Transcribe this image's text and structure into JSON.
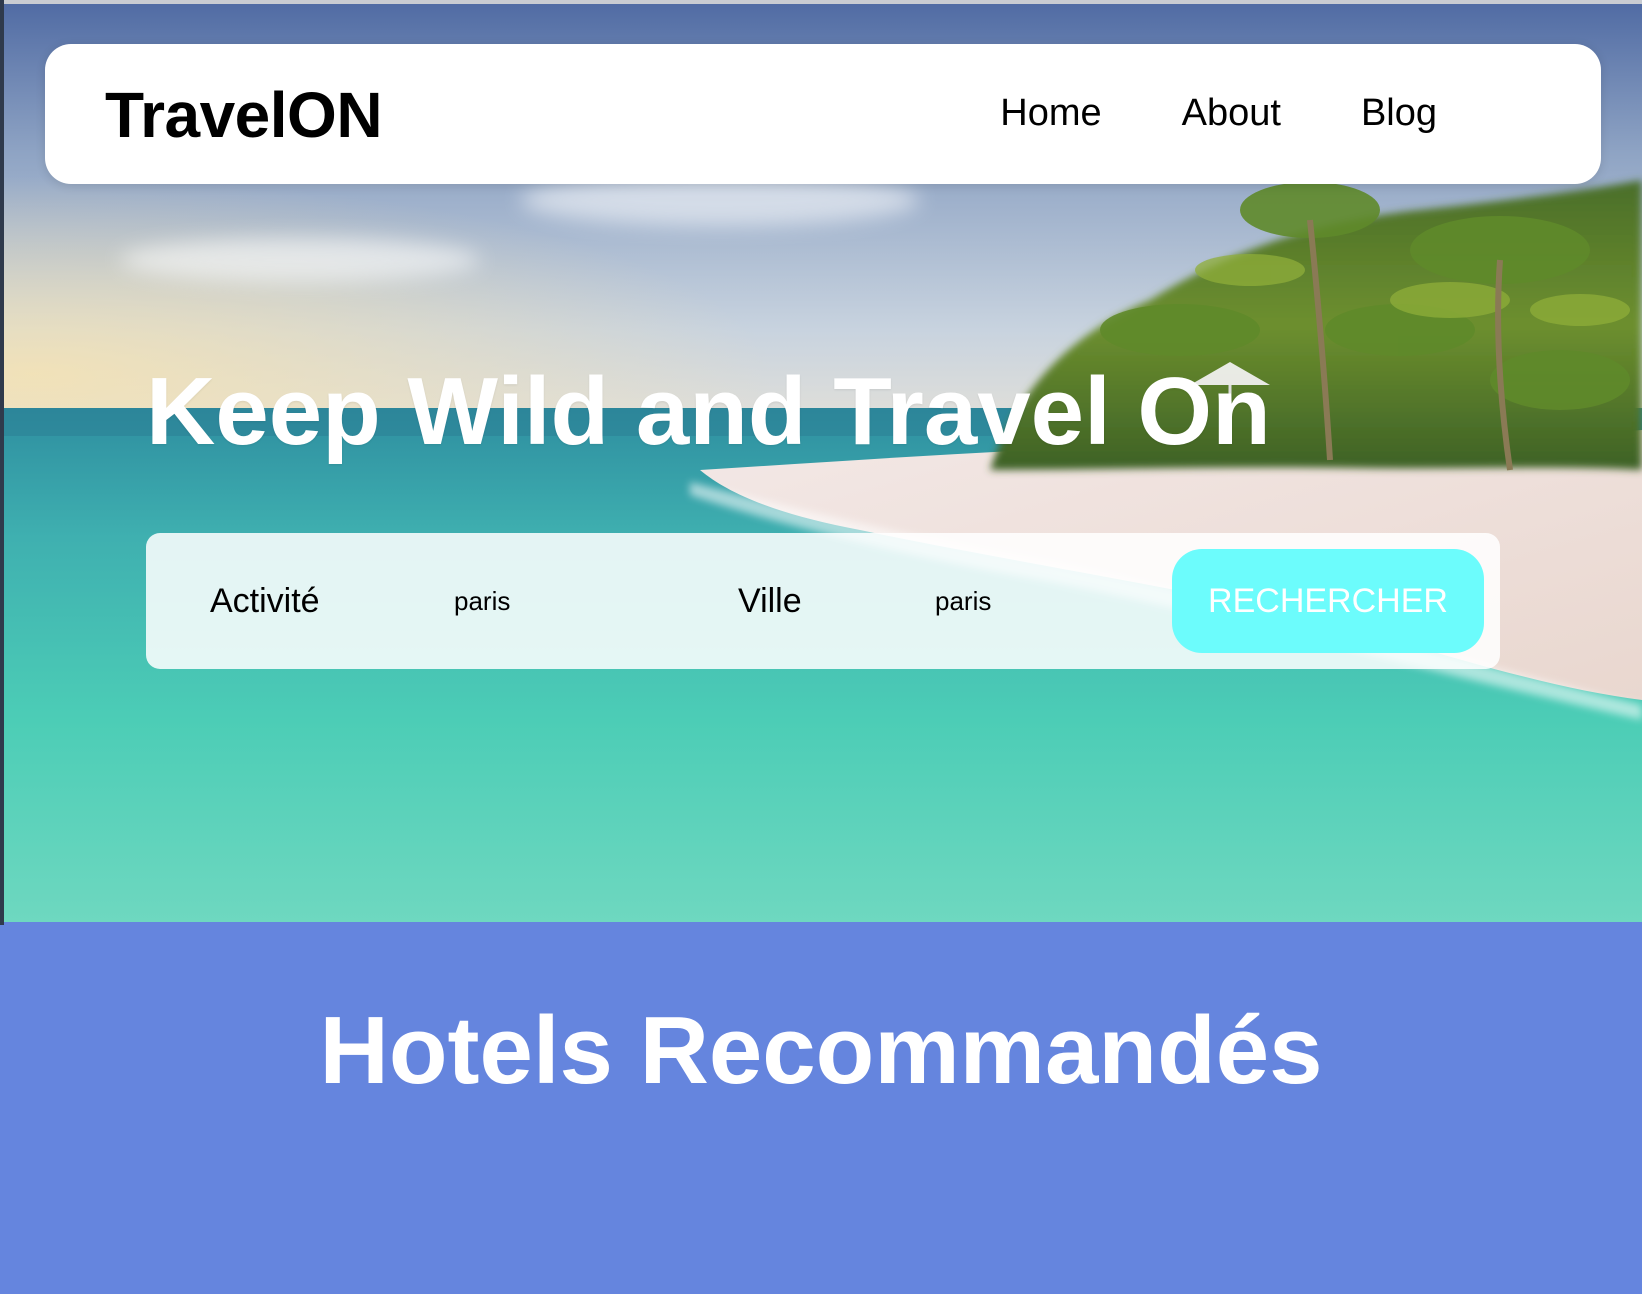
{
  "brand": {
    "name": "TravelON"
  },
  "nav": {
    "items": [
      {
        "label": "Home"
      },
      {
        "label": "About"
      },
      {
        "label": "Blog"
      }
    ]
  },
  "hero": {
    "headline": "Keep Wild and Travel On",
    "background": "tropical-beach-photo"
  },
  "search": {
    "activity_label": "Activité",
    "activity_placeholder": "paris",
    "city_label": "Ville",
    "city_placeholder": "paris",
    "button_label": "RECHERCHER"
  },
  "hotels": {
    "title": "Hotels Recommandés"
  },
  "colors": {
    "button": "#6cfcfc",
    "section_bg": "#6585de",
    "headline": "#ffffff"
  }
}
